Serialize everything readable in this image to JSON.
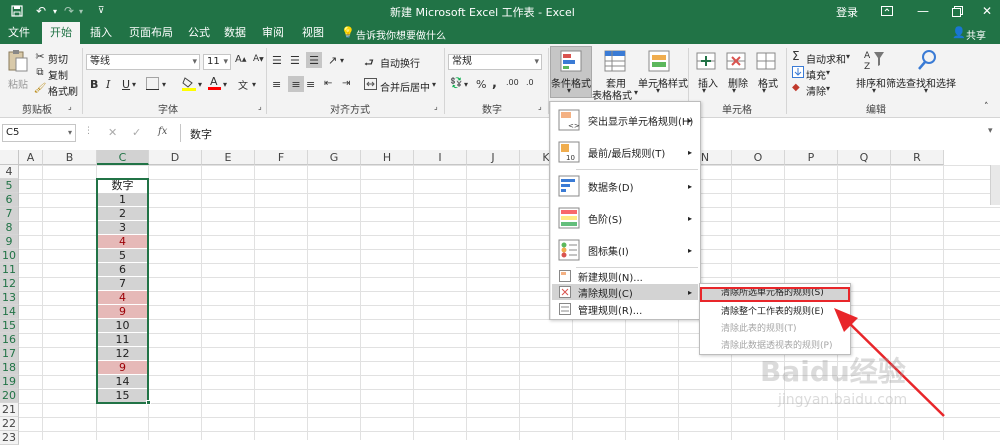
{
  "window": {
    "title": "新建 Microsoft Excel 工作表 - Excel",
    "login": "登录"
  },
  "tabs": [
    "文件",
    "开始",
    "插入",
    "页面布局",
    "公式",
    "数据",
    "审阅",
    "视图"
  ],
  "tellme": "告诉我你想要做什么",
  "share": "共享",
  "clipboard": {
    "paste": "粘贴",
    "cut": "剪切",
    "copy": "复制",
    "painter": "格式刷",
    "label": "剪贴板"
  },
  "font": {
    "name": "等线",
    "size": "11",
    "label": "字体",
    "bold": "B",
    "italic": "I",
    "underline": "U"
  },
  "alignment": {
    "wrap": "自动换行",
    "merge": "合并后居中",
    "label": "对齐方式"
  },
  "number": {
    "format": "常规",
    "label": "数字"
  },
  "styles": {
    "conditional": "条件格式",
    "table_line1": "套用",
    "table_line2": "表格格式",
    "cell_styles": "单元格样式"
  },
  "cells": {
    "insert": "插入",
    "delete": "删除",
    "format": "格式",
    "label": "单元格"
  },
  "editing": {
    "autosum": "自动求和",
    "fill": "填充",
    "clear": "清除",
    "sort": "排序和筛选",
    "find": "查找和选择",
    "label": "编辑"
  },
  "namebox": "C5",
  "fx": "fx",
  "formula": "数字",
  "columns": [
    "A",
    "B",
    "C",
    "D",
    "E",
    "F",
    "G",
    "H",
    "I",
    "J",
    "K",
    "L",
    "M",
    "N",
    "O",
    "P",
    "Q",
    "R"
  ],
  "rows": [
    "4",
    "5",
    "6",
    "7",
    "8",
    "9",
    "10",
    "11",
    "12",
    "13",
    "14",
    "15",
    "16",
    "17",
    "18",
    "19",
    "20",
    "21",
    "22",
    "23"
  ],
  "column_c": [
    "数字",
    "1",
    "2",
    "3",
    "4",
    "5",
    "6",
    "7",
    "4",
    "9",
    "10",
    "11",
    "12",
    "9",
    "14",
    "15"
  ],
  "highlight_rows": [
    9,
    13,
    14,
    18
  ],
  "menu": {
    "items": [
      "突出显示单元格规则(H)",
      "最前/最后规则(T)",
      "数据条(D)",
      "色阶(S)",
      "图标集(I)",
      "新建规则(N)...",
      "清除规则(C)",
      "管理规则(R)..."
    ],
    "submenu": [
      "清除所选单元格的规则(S)",
      "清除整个工作表的规则(E)",
      "清除此表的规则(T)",
      "清除此数据透视表的规则(P)"
    ]
  },
  "watermark": {
    "brand": "Baidu经验",
    "url": "jingyan.baidu.com"
  },
  "colors": {
    "excel_green": "#217346",
    "highlight_fill": "#e6b9b8",
    "highlight_text": "#9c0006",
    "selection_fill": "#d3d3d3",
    "annotation_red": "#e8262a"
  }
}
